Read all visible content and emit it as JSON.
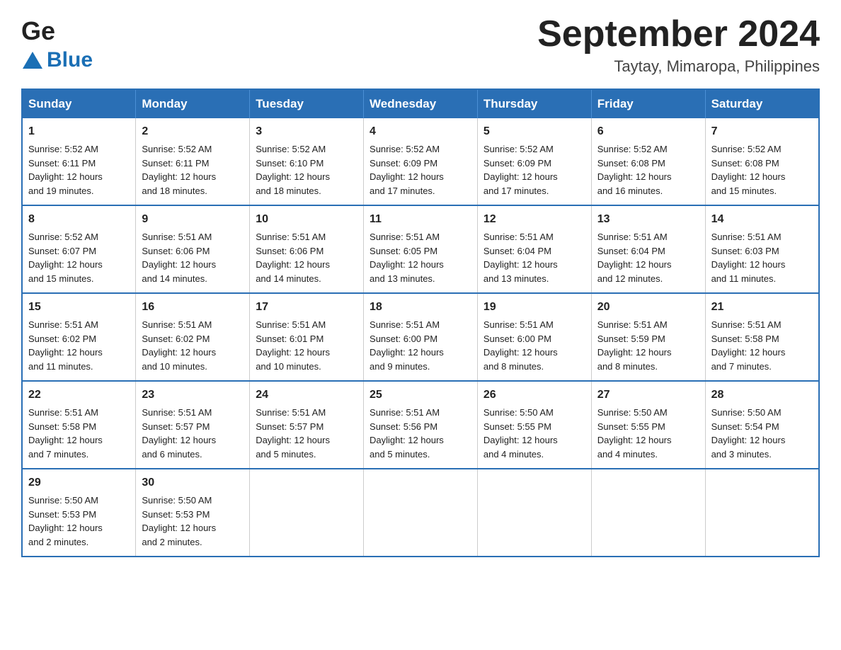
{
  "header": {
    "logo_general": "General",
    "logo_blue": "Blue",
    "title": "September 2024",
    "location": "Taytay, Mimaropa, Philippines"
  },
  "weekdays": [
    "Sunday",
    "Monday",
    "Tuesday",
    "Wednesday",
    "Thursday",
    "Friday",
    "Saturday"
  ],
  "weeks": [
    [
      {
        "day": "1",
        "sunrise": "5:52 AM",
        "sunset": "6:11 PM",
        "daylight": "12 hours and 19 minutes."
      },
      {
        "day": "2",
        "sunrise": "5:52 AM",
        "sunset": "6:11 PM",
        "daylight": "12 hours and 18 minutes."
      },
      {
        "day": "3",
        "sunrise": "5:52 AM",
        "sunset": "6:10 PM",
        "daylight": "12 hours and 18 minutes."
      },
      {
        "day": "4",
        "sunrise": "5:52 AM",
        "sunset": "6:09 PM",
        "daylight": "12 hours and 17 minutes."
      },
      {
        "day": "5",
        "sunrise": "5:52 AM",
        "sunset": "6:09 PM",
        "daylight": "12 hours and 17 minutes."
      },
      {
        "day": "6",
        "sunrise": "5:52 AM",
        "sunset": "6:08 PM",
        "daylight": "12 hours and 16 minutes."
      },
      {
        "day": "7",
        "sunrise": "5:52 AM",
        "sunset": "6:08 PM",
        "daylight": "12 hours and 15 minutes."
      }
    ],
    [
      {
        "day": "8",
        "sunrise": "5:52 AM",
        "sunset": "6:07 PM",
        "daylight": "12 hours and 15 minutes."
      },
      {
        "day": "9",
        "sunrise": "5:51 AM",
        "sunset": "6:06 PM",
        "daylight": "12 hours and 14 minutes."
      },
      {
        "day": "10",
        "sunrise": "5:51 AM",
        "sunset": "6:06 PM",
        "daylight": "12 hours and 14 minutes."
      },
      {
        "day": "11",
        "sunrise": "5:51 AM",
        "sunset": "6:05 PM",
        "daylight": "12 hours and 13 minutes."
      },
      {
        "day": "12",
        "sunrise": "5:51 AM",
        "sunset": "6:04 PM",
        "daylight": "12 hours and 13 minutes."
      },
      {
        "day": "13",
        "sunrise": "5:51 AM",
        "sunset": "6:04 PM",
        "daylight": "12 hours and 12 minutes."
      },
      {
        "day": "14",
        "sunrise": "5:51 AM",
        "sunset": "6:03 PM",
        "daylight": "12 hours and 11 minutes."
      }
    ],
    [
      {
        "day": "15",
        "sunrise": "5:51 AM",
        "sunset": "6:02 PM",
        "daylight": "12 hours and 11 minutes."
      },
      {
        "day": "16",
        "sunrise": "5:51 AM",
        "sunset": "6:02 PM",
        "daylight": "12 hours and 10 minutes."
      },
      {
        "day": "17",
        "sunrise": "5:51 AM",
        "sunset": "6:01 PM",
        "daylight": "12 hours and 10 minutes."
      },
      {
        "day": "18",
        "sunrise": "5:51 AM",
        "sunset": "6:00 PM",
        "daylight": "12 hours and 9 minutes."
      },
      {
        "day": "19",
        "sunrise": "5:51 AM",
        "sunset": "6:00 PM",
        "daylight": "12 hours and 8 minutes."
      },
      {
        "day": "20",
        "sunrise": "5:51 AM",
        "sunset": "5:59 PM",
        "daylight": "12 hours and 8 minutes."
      },
      {
        "day": "21",
        "sunrise": "5:51 AM",
        "sunset": "5:58 PM",
        "daylight": "12 hours and 7 minutes."
      }
    ],
    [
      {
        "day": "22",
        "sunrise": "5:51 AM",
        "sunset": "5:58 PM",
        "daylight": "12 hours and 7 minutes."
      },
      {
        "day": "23",
        "sunrise": "5:51 AM",
        "sunset": "5:57 PM",
        "daylight": "12 hours and 6 minutes."
      },
      {
        "day": "24",
        "sunrise": "5:51 AM",
        "sunset": "5:57 PM",
        "daylight": "12 hours and 5 minutes."
      },
      {
        "day": "25",
        "sunrise": "5:51 AM",
        "sunset": "5:56 PM",
        "daylight": "12 hours and 5 minutes."
      },
      {
        "day": "26",
        "sunrise": "5:50 AM",
        "sunset": "5:55 PM",
        "daylight": "12 hours and 4 minutes."
      },
      {
        "day": "27",
        "sunrise": "5:50 AM",
        "sunset": "5:55 PM",
        "daylight": "12 hours and 4 minutes."
      },
      {
        "day": "28",
        "sunrise": "5:50 AM",
        "sunset": "5:54 PM",
        "daylight": "12 hours and 3 minutes."
      }
    ],
    [
      {
        "day": "29",
        "sunrise": "5:50 AM",
        "sunset": "5:53 PM",
        "daylight": "12 hours and 2 minutes."
      },
      {
        "day": "30",
        "sunrise": "5:50 AM",
        "sunset": "5:53 PM",
        "daylight": "12 hours and 2 minutes."
      },
      null,
      null,
      null,
      null,
      null
    ]
  ],
  "labels": {
    "sunrise": "Sunrise:",
    "sunset": "Sunset:",
    "daylight": "Daylight:"
  }
}
